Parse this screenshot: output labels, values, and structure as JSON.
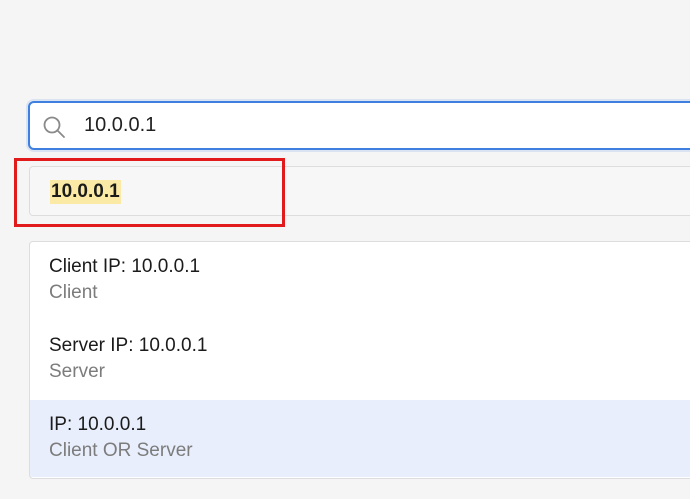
{
  "search": {
    "value": "10.0.0.1",
    "icon": "search-icon"
  },
  "exact_match": {
    "label": "10.0.0.1",
    "highlight_color": "#faeaa6"
  },
  "annotation": {
    "color": "#e11b1b"
  },
  "suggestions": [
    {
      "title": "Client IP: 10.0.0.1",
      "subtitle": "Client",
      "selected": false
    },
    {
      "title": "Server IP: 10.0.0.1",
      "subtitle": "Server",
      "selected": false
    },
    {
      "title": "IP: 10.0.0.1",
      "subtitle": "Client OR Server",
      "selected": true
    }
  ],
  "colors": {
    "focus_border": "#3f7fe0",
    "selected_row": "#e8eefc"
  }
}
